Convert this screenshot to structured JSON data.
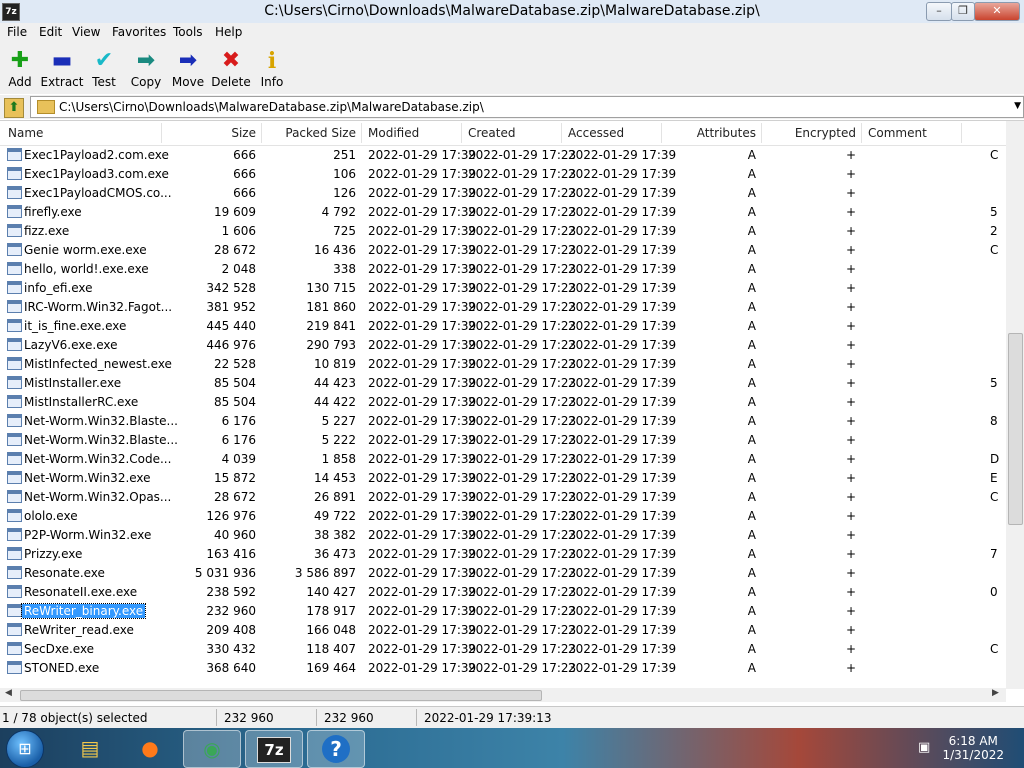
{
  "window": {
    "title": "C:\\Users\\Cirno\\Downloads\\MalwareDatabase.zip\\MalwareDatabase.zip\\",
    "app_icon": "7z"
  },
  "menu": [
    "File",
    "Edit",
    "View",
    "Favorites",
    "Tools",
    "Help"
  ],
  "toolbar": [
    {
      "label": "Add",
      "icon": "plus-icon",
      "glyph": "✚",
      "color": "#18a018"
    },
    {
      "label": "Extract",
      "icon": "minus-icon",
      "glyph": "▬",
      "color": "#1a2eb8"
    },
    {
      "label": "Test",
      "icon": "check-icon",
      "glyph": "✔",
      "color": "#19b9c8"
    },
    {
      "label": "Copy",
      "icon": "copy-arrow-icon",
      "glyph": "➡",
      "color": "#1a8a80"
    },
    {
      "label": "Move",
      "icon": "move-arrow-icon",
      "glyph": "➡",
      "color": "#1a2eb8"
    },
    {
      "label": "Delete",
      "icon": "delete-x-icon",
      "glyph": "✖",
      "color": "#d81b1b"
    },
    {
      "label": "Info",
      "icon": "info-icon",
      "glyph": "i",
      "color": "#d8a400"
    }
  ],
  "address": {
    "path": "C:\\Users\\Cirno\\Downloads\\MalwareDatabase.zip\\MalwareDatabase.zip\\"
  },
  "columns": [
    "Name",
    "Size",
    "Packed Size",
    "Modified",
    "Created",
    "Accessed",
    "Attributes",
    "Encrypted",
    "Comment"
  ],
  "files": [
    {
      "name": "Exec1Payload2.com.exe",
      "size": "666",
      "packed": "251",
      "modified": "2022-01-29 17:39",
      "created": "2022-01-29 17:23",
      "accessed": "2022-01-29 17:39",
      "attr": "A",
      "enc": "+",
      "comment": "C"
    },
    {
      "name": "Exec1Payload3.com.exe",
      "size": "666",
      "packed": "106",
      "modified": "2022-01-29 17:39",
      "created": "2022-01-29 17:23",
      "accessed": "2022-01-29 17:39",
      "attr": "A",
      "enc": "+",
      "comment": ""
    },
    {
      "name": "Exec1PayloadCMOS.co...",
      "size": "666",
      "packed": "126",
      "modified": "2022-01-29 17:39",
      "created": "2022-01-29 17:23",
      "accessed": "2022-01-29 17:39",
      "attr": "A",
      "enc": "+",
      "comment": ""
    },
    {
      "name": "firefly.exe",
      "size": "19 609",
      "packed": "4 792",
      "modified": "2022-01-29 17:39",
      "created": "2022-01-29 17:23",
      "accessed": "2022-01-29 17:39",
      "attr": "A",
      "enc": "+",
      "comment": "5"
    },
    {
      "name": "fizz.exe",
      "size": "1 606",
      "packed": "725",
      "modified": "2022-01-29 17:39",
      "created": "2022-01-29 17:23",
      "accessed": "2022-01-29 17:39",
      "attr": "A",
      "enc": "+",
      "comment": "2"
    },
    {
      "name": "Genie worm.exe.exe",
      "size": "28 672",
      "packed": "16 436",
      "modified": "2022-01-29 17:39",
      "created": "2022-01-29 17:23",
      "accessed": "2022-01-29 17:39",
      "attr": "A",
      "enc": "+",
      "comment": "C"
    },
    {
      "name": "hello, world!.exe.exe",
      "size": "2 048",
      "packed": "338",
      "modified": "2022-01-29 17:39",
      "created": "2022-01-29 17:23",
      "accessed": "2022-01-29 17:39",
      "attr": "A",
      "enc": "+",
      "comment": ""
    },
    {
      "name": "info_efi.exe",
      "size": "342 528",
      "packed": "130 715",
      "modified": "2022-01-29 17:39",
      "created": "2022-01-29 17:23",
      "accessed": "2022-01-29 17:39",
      "attr": "A",
      "enc": "+",
      "comment": ""
    },
    {
      "name": "IRC-Worm.Win32.Fagot...",
      "size": "381 952",
      "packed": "181 860",
      "modified": "2022-01-29 17:39",
      "created": "2022-01-29 17:23",
      "accessed": "2022-01-29 17:39",
      "attr": "A",
      "enc": "+",
      "comment": ""
    },
    {
      "name": "it_is_fine.exe.exe",
      "size": "445 440",
      "packed": "219 841",
      "modified": "2022-01-29 17:39",
      "created": "2022-01-29 17:23",
      "accessed": "2022-01-29 17:39",
      "attr": "A",
      "enc": "+",
      "comment": ""
    },
    {
      "name": "LazyV6.exe.exe",
      "size": "446 976",
      "packed": "290 793",
      "modified": "2022-01-29 17:39",
      "created": "2022-01-29 17:23",
      "accessed": "2022-01-29 17:39",
      "attr": "A",
      "enc": "+",
      "comment": ""
    },
    {
      "name": "MistInfected_newest.exe",
      "size": "22 528",
      "packed": "10 819",
      "modified": "2022-01-29 17:39",
      "created": "2022-01-29 17:23",
      "accessed": "2022-01-29 17:39",
      "attr": "A",
      "enc": "+",
      "comment": ""
    },
    {
      "name": "MistInstaller.exe",
      "size": "85 504",
      "packed": "44 423",
      "modified": "2022-01-29 17:39",
      "created": "2022-01-29 17:23",
      "accessed": "2022-01-29 17:39",
      "attr": "A",
      "enc": "+",
      "comment": "5"
    },
    {
      "name": "MistInstallerRC.exe",
      "size": "85 504",
      "packed": "44 422",
      "modified": "2022-01-29 17:39",
      "created": "2022-01-29 17:23",
      "accessed": "2022-01-29 17:39",
      "attr": "A",
      "enc": "+",
      "comment": ""
    },
    {
      "name": "Net-Worm.Win32.Blaste...",
      "size": "6 176",
      "packed": "5 227",
      "modified": "2022-01-29 17:39",
      "created": "2022-01-29 17:23",
      "accessed": "2022-01-29 17:39",
      "attr": "A",
      "enc": "+",
      "comment": "8"
    },
    {
      "name": "Net-Worm.Win32.Blaste...",
      "size": "6 176",
      "packed": "5 222",
      "modified": "2022-01-29 17:39",
      "created": "2022-01-29 17:23",
      "accessed": "2022-01-29 17:39",
      "attr": "A",
      "enc": "+",
      "comment": ""
    },
    {
      "name": "Net-Worm.Win32.Code...",
      "size": "4 039",
      "packed": "1 858",
      "modified": "2022-01-29 17:39",
      "created": "2022-01-29 17:23",
      "accessed": "2022-01-29 17:39",
      "attr": "A",
      "enc": "+",
      "comment": "D"
    },
    {
      "name": "Net-Worm.Win32.exe",
      "size": "15 872",
      "packed": "14 453",
      "modified": "2022-01-29 17:39",
      "created": "2022-01-29 17:23",
      "accessed": "2022-01-29 17:39",
      "attr": "A",
      "enc": "+",
      "comment": "E"
    },
    {
      "name": "Net-Worm.Win32.Opas...",
      "size": "28 672",
      "packed": "26 891",
      "modified": "2022-01-29 17:39",
      "created": "2022-01-29 17:23",
      "accessed": "2022-01-29 17:39",
      "attr": "A",
      "enc": "+",
      "comment": "C"
    },
    {
      "name": "ololo.exe",
      "size": "126 976",
      "packed": "49 722",
      "modified": "2022-01-29 17:39",
      "created": "2022-01-29 17:23",
      "accessed": "2022-01-29 17:39",
      "attr": "A",
      "enc": "+",
      "comment": ""
    },
    {
      "name": "P2P-Worm.Win32.exe",
      "size": "40 960",
      "packed": "38 382",
      "modified": "2022-01-29 17:39",
      "created": "2022-01-29 17:23",
      "accessed": "2022-01-29 17:39",
      "attr": "A",
      "enc": "+",
      "comment": ""
    },
    {
      "name": "Prizzy.exe",
      "size": "163 416",
      "packed": "36 473",
      "modified": "2022-01-29 17:39",
      "created": "2022-01-29 17:23",
      "accessed": "2022-01-29 17:39",
      "attr": "A",
      "enc": "+",
      "comment": "7"
    },
    {
      "name": "Resonate.exe",
      "size": "5 031 936",
      "packed": "3 586 897",
      "modified": "2022-01-29 17:39",
      "created": "2022-01-29 17:23",
      "accessed": "2022-01-29 17:39",
      "attr": "A",
      "enc": "+",
      "comment": ""
    },
    {
      "name": "ResonateII.exe.exe",
      "size": "238 592",
      "packed": "140 427",
      "modified": "2022-01-29 17:39",
      "created": "2022-01-29 17:23",
      "accessed": "2022-01-29 17:39",
      "attr": "A",
      "enc": "+",
      "comment": "0"
    },
    {
      "name": "ReWriter_binary.exe",
      "size": "232 960",
      "packed": "178 917",
      "modified": "2022-01-29 17:39",
      "created": "2022-01-29 17:23",
      "accessed": "2022-01-29 17:39",
      "attr": "A",
      "enc": "+",
      "comment": "",
      "selected": true
    },
    {
      "name": "ReWriter_read.exe",
      "size": "209 408",
      "packed": "166 048",
      "modified": "2022-01-29 17:39",
      "created": "2022-01-29 17:23",
      "accessed": "2022-01-29 17:39",
      "attr": "A",
      "enc": "+",
      "comment": ""
    },
    {
      "name": "SecDxe.exe",
      "size": "330 432",
      "packed": "118 407",
      "modified": "2022-01-29 17:39",
      "created": "2022-01-29 17:23",
      "accessed": "2022-01-29 17:39",
      "attr": "A",
      "enc": "+",
      "comment": "C"
    },
    {
      "name": "STONED.exe",
      "size": "368 640",
      "packed": "169 464",
      "modified": "2022-01-29 17:39",
      "created": "2022-01-29 17:23",
      "accessed": "2022-01-29 17:39",
      "attr": "A",
      "enc": "+",
      "comment": ""
    }
  ],
  "status": {
    "selection": "1 / 78 object(s) selected",
    "size": "232 960",
    "packed": "232 960",
    "modified": "2022-01-29 17:39:13"
  },
  "taskbar": {
    "apps": [
      {
        "name": "explorer",
        "icon": "folder-icon",
        "glyph": "▤",
        "color": "#f1c84b"
      },
      {
        "name": "firefox",
        "icon": "firefox-icon",
        "glyph": "●",
        "color": "#ff7a1a"
      },
      {
        "name": "chrome",
        "icon": "chrome-icon",
        "glyph": "◉",
        "color": "#3aa757"
      },
      {
        "name": "7-zip",
        "icon": "7zip-icon",
        "glyph": "7z",
        "color": "#ffffff"
      },
      {
        "name": "help",
        "icon": "help-icon",
        "glyph": "?",
        "color": "#ffffff"
      }
    ],
    "clock_time": "6:18 AM",
    "clock_date": "1/31/2022"
  }
}
